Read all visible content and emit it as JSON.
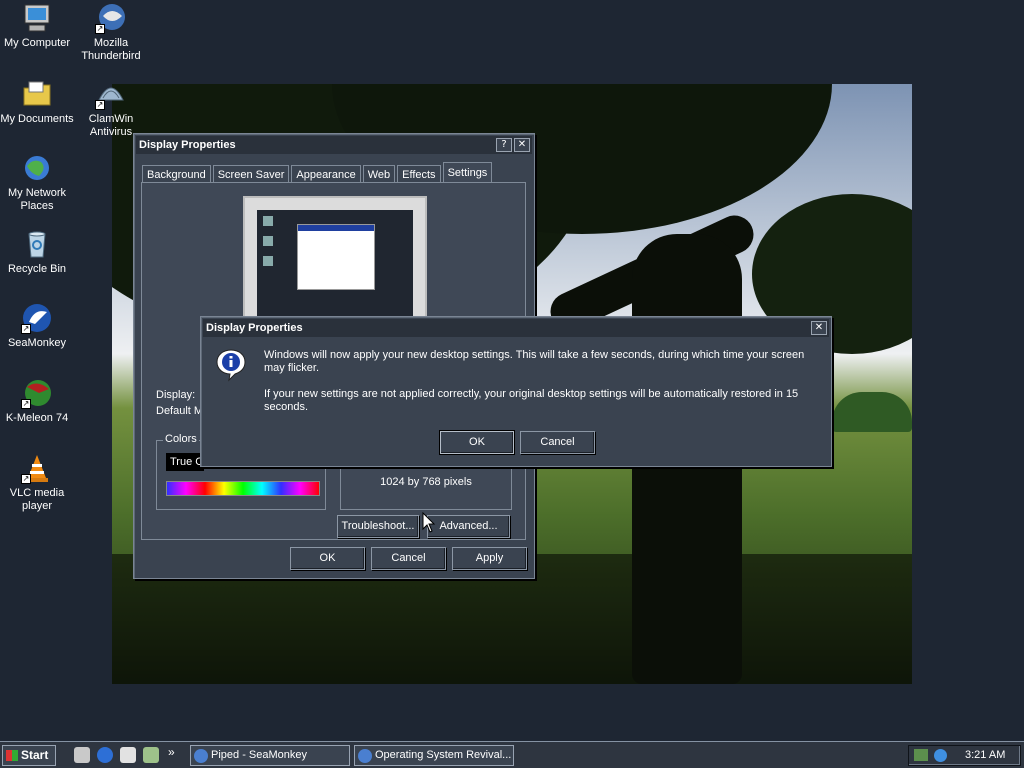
{
  "desktop_icons": [
    {
      "label": "My Computer",
      "icon": "computer-icon"
    },
    {
      "label": "Mozilla Thunderbird",
      "icon": "thunderbird-icon"
    },
    {
      "label": "My Documents",
      "icon": "folder-icon"
    },
    {
      "label": "ClamWin Antivirus",
      "icon": "clamwin-icon"
    },
    {
      "label": "My Network Places",
      "icon": "network-icon"
    },
    {
      "label": "Recycle Bin",
      "icon": "recycle-bin-icon"
    },
    {
      "label": "SeaMonkey",
      "icon": "seamonkey-icon"
    },
    {
      "label": "K-Meleon 74",
      "icon": "kmeleon-icon"
    },
    {
      "label": "VLC media player",
      "icon": "vlc-icon"
    }
  ],
  "display_props": {
    "title": "Display Properties",
    "help_btn": "?",
    "close_btn": "✕",
    "tabs": [
      "Background",
      "Screen Saver",
      "Appearance",
      "Web",
      "Effects",
      "Settings"
    ],
    "active_tab": "Settings",
    "display_label": "Display:",
    "display_value": "Default M",
    "colors_label": "Colors",
    "colors_value": "True C",
    "resolution_text": "1024 by 768 pixels",
    "troubleshoot": "Troubleshoot...",
    "advanced": "Advanced...",
    "ok": "OK",
    "cancel": "Cancel",
    "apply": "Apply"
  },
  "dialog": {
    "title": "Display Properties",
    "close_btn": "✕",
    "message1": "Windows will now apply your new desktop settings. This will take a few seconds, during which time your screen may flicker.",
    "message2": "If your new settings are not applied correctly, your original desktop settings will be automatically restored in 15 seconds.",
    "ok": "OK",
    "cancel": "Cancel",
    "icon": "info-icon"
  },
  "taskbar": {
    "start": "Start",
    "chevron": "»",
    "tasks": [
      {
        "label": "Piped - SeaMonkey"
      },
      {
        "label": "Operating System Revival..."
      }
    ],
    "clock": "3:21 AM"
  }
}
